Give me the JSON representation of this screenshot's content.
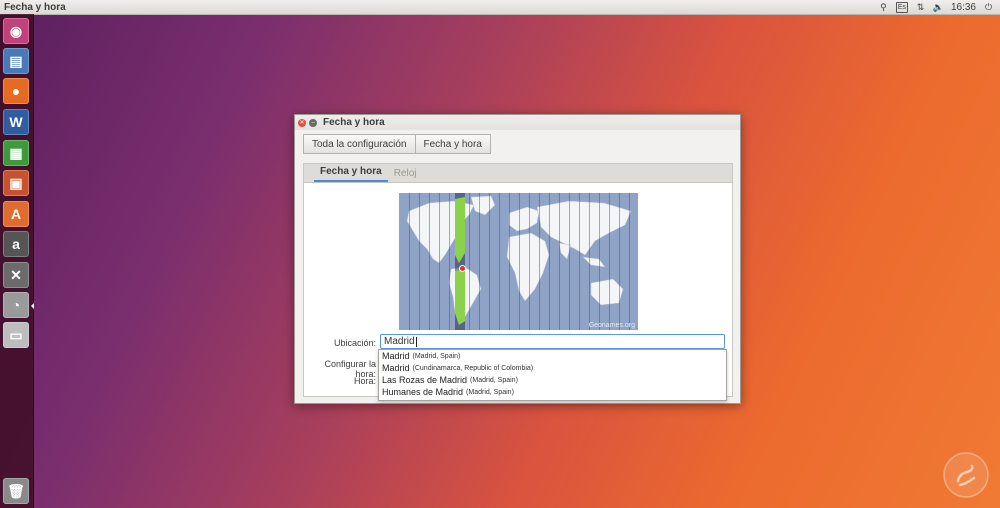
{
  "topbar": {
    "title": "Fecha y hora",
    "keyboard_layout": "Es",
    "time": "16:36"
  },
  "launcher": {
    "items": [
      {
        "name": "ubuntu-dash-icon",
        "glyph": "◉",
        "color": "#c2417a"
      },
      {
        "name": "files-icon",
        "glyph": "▤",
        "color": "#4a79b8"
      },
      {
        "name": "firefox-icon",
        "glyph": "●",
        "color": "#e66a1f"
      },
      {
        "name": "writer-icon",
        "glyph": "W",
        "color": "#2f5d9f"
      },
      {
        "name": "calc-icon",
        "glyph": "▦",
        "color": "#3f9a3c"
      },
      {
        "name": "impress-icon",
        "glyph": "▣",
        "color": "#c9522e"
      },
      {
        "name": "software-center-icon",
        "glyph": "A",
        "color": "#e06b2f"
      },
      {
        "name": "amazon-icon",
        "glyph": "a",
        "color": "#555"
      },
      {
        "name": "settings-icon",
        "glyph": "✕",
        "color": "#6b6b6b"
      },
      {
        "name": "clock-icon",
        "glyph": "◔",
        "color": "#9a9a9a"
      },
      {
        "name": "drive-icon",
        "glyph": "▭",
        "color": "#bdbdbd"
      }
    ],
    "trash": {
      "name": "trash-icon",
      "glyph": "🗑",
      "color": "#8a8a8a"
    }
  },
  "dialog": {
    "title": "Fecha y hora",
    "nav": {
      "all_settings": "Toda la configuración",
      "current": "Fecha y hora"
    },
    "tabs": [
      {
        "label": "Fecha y hora",
        "active": true
      },
      {
        "label": "Reloj",
        "active": false
      }
    ],
    "map": {
      "credit": "Geonames.org"
    },
    "form": {
      "location_label": "Ubicación:",
      "location_value": "Madrid",
      "set_time_label": "Configurar la hora:",
      "time_label": "Hora:"
    },
    "suggestions": [
      {
        "name": "Madrid",
        "detail": "(Madrid, Spain)"
      },
      {
        "name": "Madrid",
        "detail": "(Cundinamarca, Republic of Colombia)"
      },
      {
        "name": "Las Rozas de Madrid",
        "detail": "(Madrid, Spain)"
      },
      {
        "name": "Humanes de Madrid",
        "detail": "(Madrid, Spain)"
      }
    ]
  },
  "colors": {
    "accent": "#4a8ad6",
    "panel": "#dcdad5",
    "launcher": "#3c0c22",
    "timezone_highlight": "#8bd14a"
  }
}
